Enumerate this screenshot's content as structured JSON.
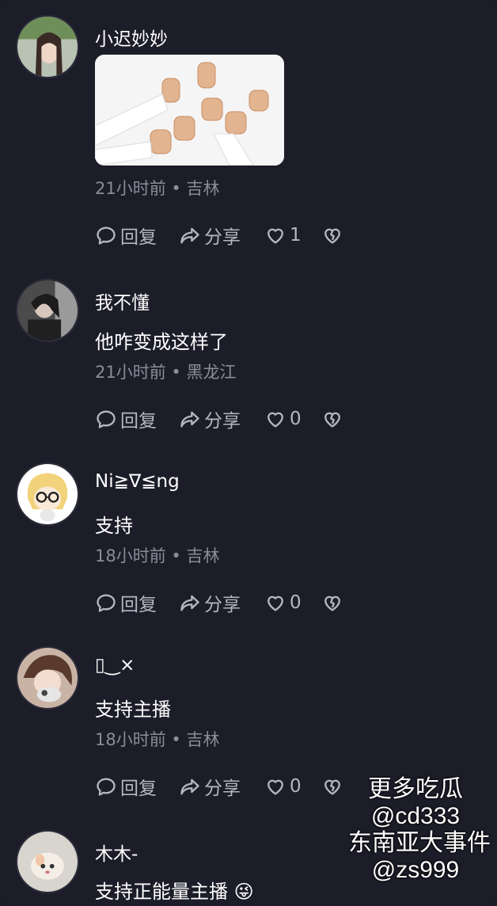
{
  "comments": [
    {
      "username": "小迟妙妙",
      "text": "",
      "meta": "21小时前 • 吉林",
      "reply_label": "回复",
      "share_label": "分享",
      "like_count": "1"
    },
    {
      "username": "我不懂",
      "text": "他咋变成这样了",
      "meta": "21小时前 • 黑龙江",
      "reply_label": "回复",
      "share_label": "分享",
      "like_count": "0"
    },
    {
      "username": "Ni≧∇≦ng",
      "text": "支持",
      "meta": "18小时前 • 吉林",
      "reply_label": "回复",
      "share_label": "分享",
      "like_count": "0"
    },
    {
      "username": "▯‿×",
      "text": "支持主播",
      "meta": "18小时前 • 吉林",
      "reply_label": "回复",
      "share_label": "分享",
      "like_count": "0"
    },
    {
      "username": "木木-",
      "text": "支持正能量主播 😜"
    }
  ],
  "watermark": {
    "line1": "更多吃瓜",
    "line2": "@cd333",
    "line3": "东南亚大事件",
    "line4": "@zs999"
  },
  "icons": {
    "reply": "comment-bubble-icon",
    "share": "share-arrow-icon",
    "like": "heart-icon",
    "dislike": "broken-heart-icon"
  },
  "colors": {
    "background": "#1c1d29",
    "muted_text": "#8a8c98",
    "action_text": "#b4b6c0"
  }
}
